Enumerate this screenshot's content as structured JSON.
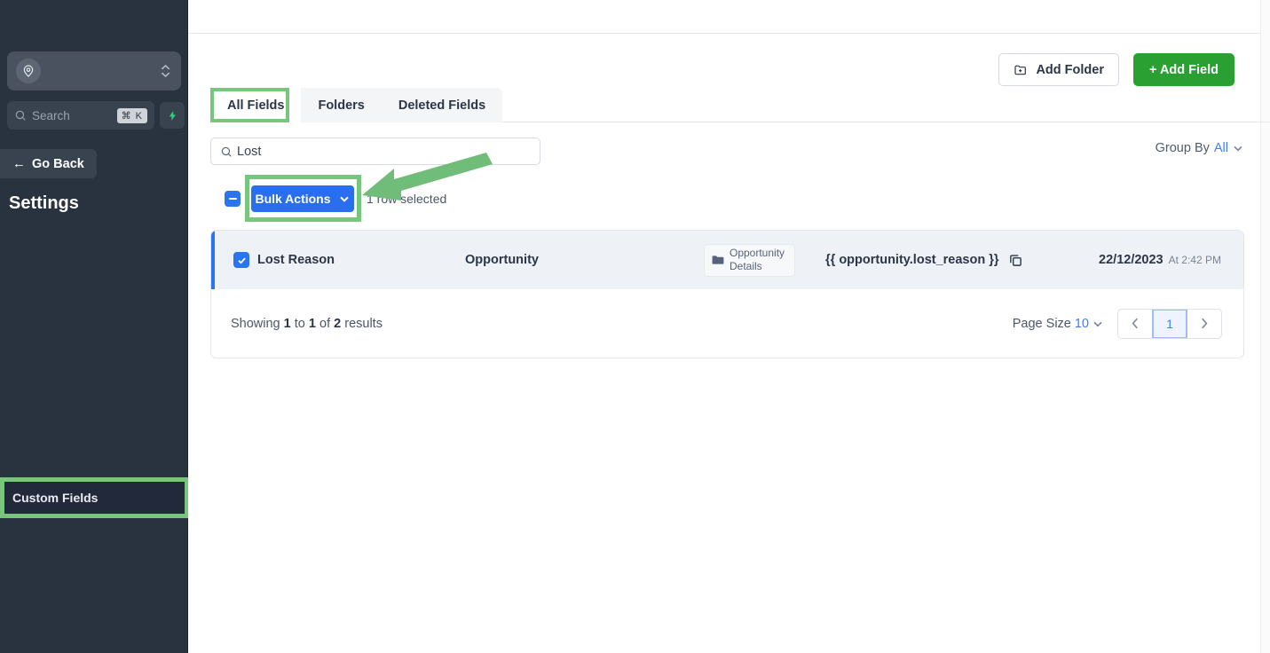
{
  "sidebar": {
    "location_selector": {
      "icon": "location-pin-icon",
      "value": ""
    },
    "search": {
      "placeholder": "Search",
      "shortcut": "⌘ K",
      "icon": "search-icon",
      "bolt_icon": "bolt-icon"
    },
    "go_back_label": "Go Back",
    "go_back_arrow": "←",
    "title": "Settings",
    "active_item": "Custom Fields",
    "highlight_color": "#78c57e"
  },
  "header": {
    "add_folder_label": "Add Folder",
    "add_folder_icon": "folder-plus-icon",
    "add_field_label": "+ Add Field",
    "add_field_color": "#2aa033"
  },
  "tabs": [
    {
      "label": "All Fields",
      "active": true
    },
    {
      "label": "Folders",
      "active": false
    },
    {
      "label": "Deleted Fields",
      "active": false
    }
  ],
  "toolbar": {
    "search_value": "Lost",
    "search_placeholder": "Search",
    "search_icon": "search-icon",
    "group_by_label": "Group By",
    "group_by_value": "All",
    "chevron_icon": "chevron-down-icon"
  },
  "bulk_bar": {
    "select_all_state": "indeterminate",
    "button_label": "Bulk Actions",
    "button_color": "#2a6ef0",
    "button_chevron": "chevron-down-icon",
    "selection_text": "1 row selected"
  },
  "table": {
    "rows": [
      {
        "selected": true,
        "name": "Lost Reason",
        "object": "Opportunity",
        "folder": "Opportunity Details",
        "folder_icon": "folder-icon",
        "merge_tag": "{{ opportunity.lost_reason }}",
        "copy_icon": "copy-icon",
        "date": "22/12/2023",
        "time": "At 2:42 PM"
      }
    ]
  },
  "footer": {
    "showing_prefix": "Showing",
    "showing_from": "1",
    "showing_mid": "to",
    "showing_to": "1",
    "showing_of": "of",
    "showing_total": "2",
    "showing_suffix": "results",
    "page_size_label": "Page Size",
    "page_size_value": "10",
    "prev_icon": "chevron-left-icon",
    "next_icon": "chevron-right-icon",
    "current_page": "1"
  },
  "annotations": {
    "arrow_color": "#6fbd78",
    "arrow_target": "bulk-actions-button"
  }
}
